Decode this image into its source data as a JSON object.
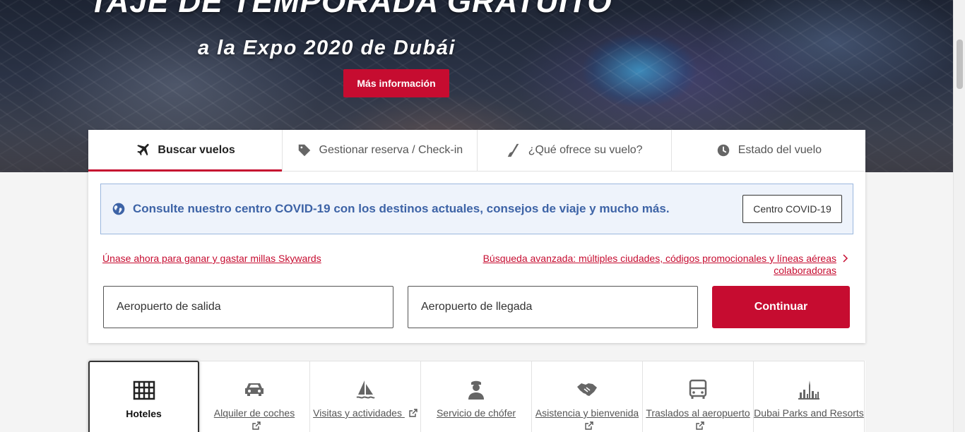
{
  "hero": {
    "title": "TAJE DE TEMPORADA GRATUITO",
    "subtitle": "a la Expo 2020 de Dubái",
    "button_label": "Más información"
  },
  "tabs": [
    {
      "label": "Buscar vuelos",
      "icon": "plane-icon",
      "active": true
    },
    {
      "label": "Gestionar reserva / Check-in",
      "icon": "tag-icon",
      "active": false
    },
    {
      "label": "¿Qué ofrece su vuelo?",
      "icon": "seat-icon",
      "active": false
    },
    {
      "label": "Estado del vuelo",
      "icon": "clock-icon",
      "active": false
    }
  ],
  "covid": {
    "message": "Consulte nuestro centro COVID-19 con los destinos actuales, consejos de viaje y mucho más.",
    "button_label": "Centro COVID-19"
  },
  "links": {
    "skywards": "Únase ahora para ganar y gastar millas Skywards",
    "advanced": "Búsqueda avanzada: múltiples ciudades, códigos promocionales y líneas aéreas colaboradoras"
  },
  "form": {
    "departure_placeholder": "Aeropuerto de salida",
    "arrival_placeholder": "Aeropuerto de llegada",
    "continue_label": "Continuar"
  },
  "services": [
    {
      "label": "Hoteles",
      "icon": "hotel-icon",
      "external": false,
      "active": true
    },
    {
      "label": "Alquiler de coches",
      "icon": "car-icon",
      "external": true,
      "active": false
    },
    {
      "label": "Visitas y actividades",
      "icon": "sailboat-icon",
      "external": true,
      "active": false
    },
    {
      "label": "Servicio de chófer",
      "icon": "chauffeur-icon",
      "external": false,
      "active": false
    },
    {
      "label": "Asistencia y bienvenida",
      "icon": "handshake-icon",
      "external": true,
      "active": false
    },
    {
      "label": "Traslados al aeropuerto",
      "icon": "bus-icon",
      "external": true,
      "active": false
    },
    {
      "label": "Dubai Parks and Resorts",
      "icon": "skyline-icon",
      "external": false,
      "active": false
    }
  ],
  "colors": {
    "brand_red": "#c60c30",
    "covid_blue": "#3d63a6",
    "covid_bg": "#eef3fb"
  }
}
